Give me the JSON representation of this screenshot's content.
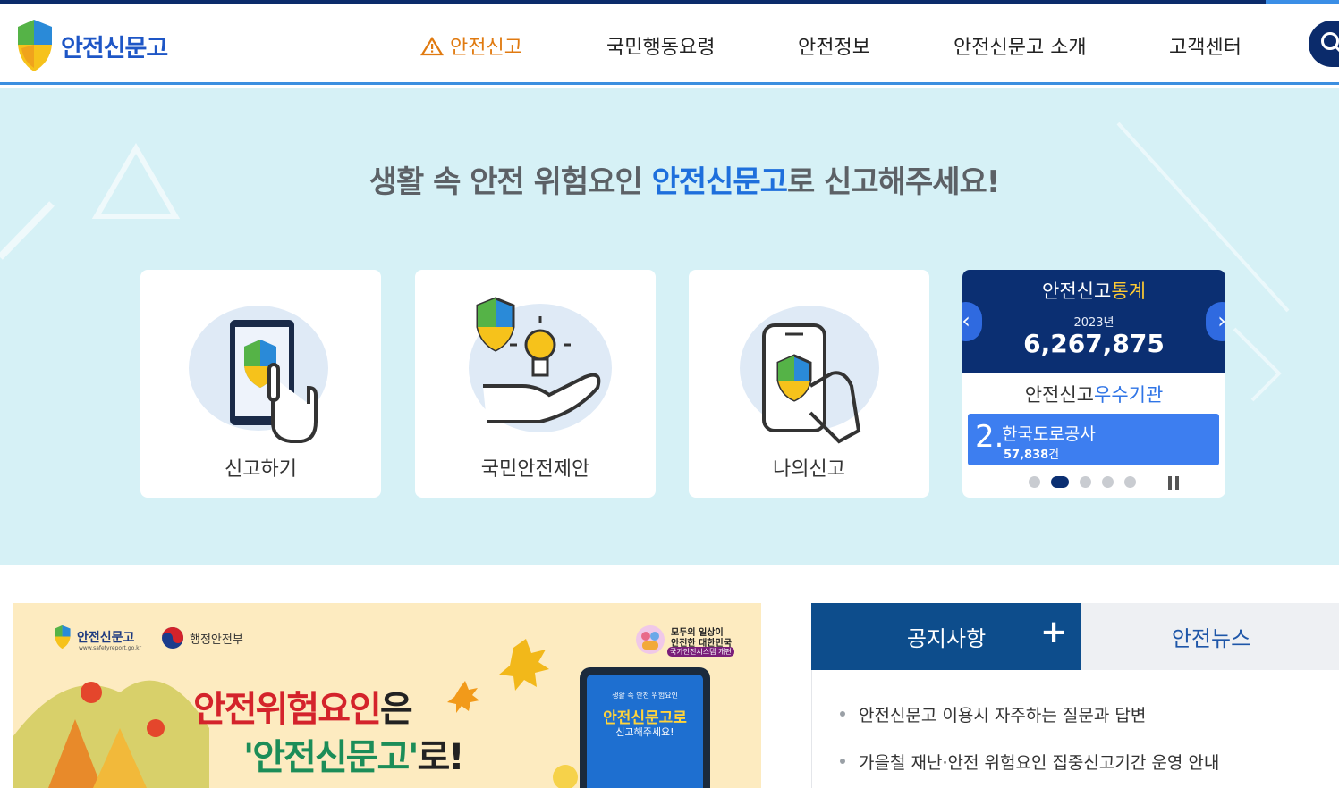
{
  "brand": {
    "name": "안전신문고"
  },
  "nav": {
    "items": [
      {
        "label": "안전신고"
      },
      {
        "label": "국민행동요령"
      },
      {
        "label": "안전정보"
      },
      {
        "label": "안전신문고 소개"
      },
      {
        "label": "고객센터"
      }
    ]
  },
  "hero": {
    "title_pre": "생활 속 안전 위험요인 ",
    "title_highlight": "안전신문고",
    "title_post": "로 신고해주세요!"
  },
  "cards": [
    {
      "label": "신고하기"
    },
    {
      "label": "국민안전제안"
    },
    {
      "label": "나의신고"
    }
  ],
  "stats": {
    "title_main": "안전신고",
    "title_accent": "통계",
    "year": "2023년",
    "count": "6,267,875",
    "prev": "‹",
    "next": "›",
    "excellent_main": "안전신고",
    "excellent_accent": "우수기관",
    "rank": "2.",
    "org": "한국도로공사",
    "org_count": "57,838",
    "org_unit": "건"
  },
  "banner": {
    "logo_text": "안전신문고",
    "url": "www.safetyreport.go.kr",
    "ministry": "행정안전부",
    "badge_line1": "모두의 일상이",
    "badge_line2_a": "안전한",
    "badge_line2_b": " 대한민국",
    "badge_line3": "국가안전시스템 개편",
    "head1_red": "안전위험요인",
    "head1_dark": "은",
    "head2_green": "'안전신문고'",
    "head2_dark": "로!",
    "phone_line1": "생활 속 안전 위험요인",
    "phone_line2": "안전신문고로",
    "phone_line3": "신고해주세요!"
  },
  "board": {
    "tab_notice": "공지사항",
    "tab_news": "안전뉴스",
    "plus": "+",
    "items": [
      {
        "title": "안전신문고 이용시 자주하는 질문과 답변"
      },
      {
        "title": "가을철 재난·안전 위험요인 집중신고기간 운영 안내"
      }
    ]
  },
  "colors": {
    "navy": "#0b2f72",
    "accent_orange": "#e07a10",
    "hero_bg": "#d6f1f6",
    "blue": "#1e6fdc"
  }
}
